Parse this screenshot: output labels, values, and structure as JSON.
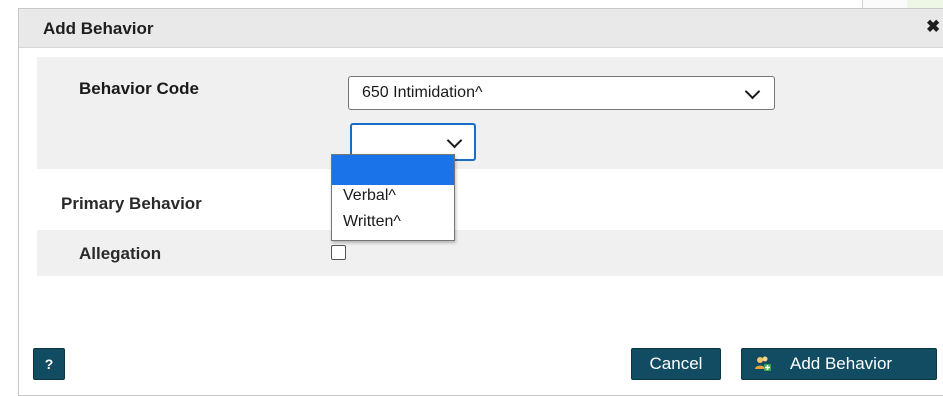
{
  "dialog": {
    "title": "Add Behavior",
    "close_glyph": "✖"
  },
  "form": {
    "behavior_code_label": "Behavior Code",
    "behavior_code_value": "650 Intimidation^",
    "sub_select_value": "",
    "dropdown_options": [
      "",
      "Verbal^",
      "Written^"
    ],
    "primary_behavior_label": "Primary Behavior",
    "allegation_label": "Allegation",
    "allegation_checked": false
  },
  "footer": {
    "help_label": "?",
    "cancel_label": "Cancel",
    "add_label": "Add Behavior",
    "add_icon": "users-plus-icon"
  },
  "colors": {
    "primary_button": "#124c63",
    "selected_option": "#1a73e8",
    "row_background": "#f0f0f0"
  }
}
